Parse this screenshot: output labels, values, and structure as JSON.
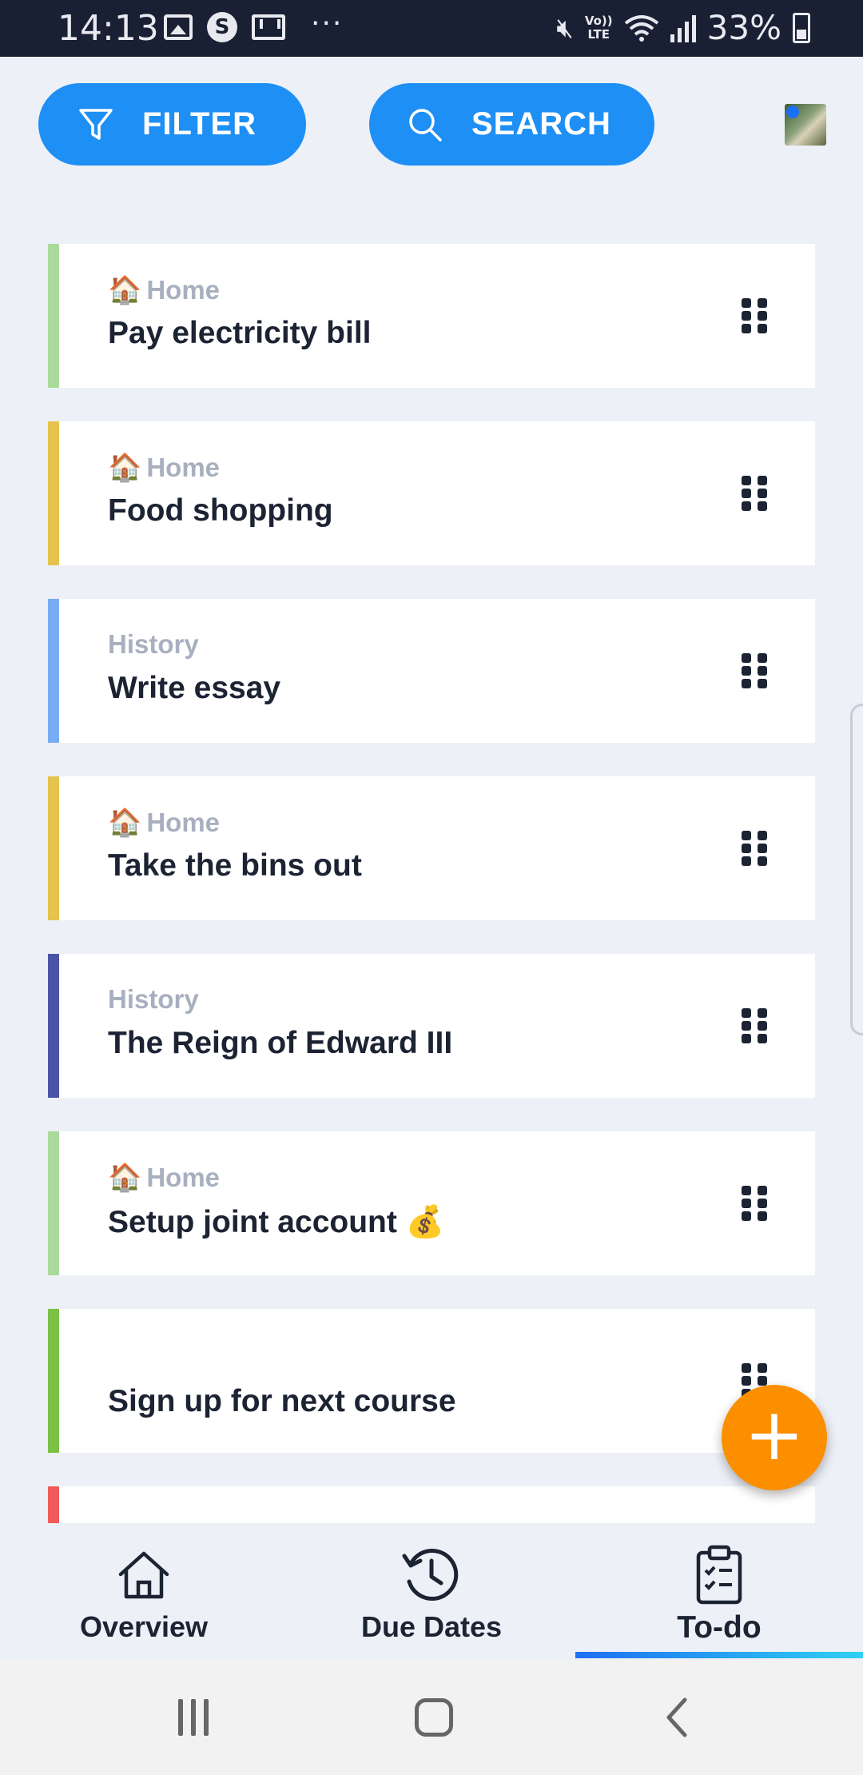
{
  "status_bar": {
    "time": "14:13",
    "volte": "Vo))\nLTE",
    "battery": "33%"
  },
  "toolbar": {
    "filter_label": "FILTER",
    "search_label": "SEARCH"
  },
  "colors": {
    "accent": "#1e8ff5",
    "fab": "#fb8f00",
    "text_dark": "#1c2333",
    "category_grey": "#a8b0c0"
  },
  "tasks": [
    {
      "category": "Home",
      "category_icon": "house-emoji",
      "title": "Pay electricity bill",
      "bar_color": "#a9d99b"
    },
    {
      "category": "Home",
      "category_icon": "house-emoji",
      "title": "Food shopping",
      "bar_color": "#e5c34d"
    },
    {
      "category": "History",
      "category_icon": "",
      "title": "Write essay",
      "bar_color": "#7aabf5"
    },
    {
      "category": "Home",
      "category_icon": "house-emoji",
      "title": "Take the bins out",
      "bar_color": "#e5c34d"
    },
    {
      "category": "History",
      "category_icon": "",
      "title": "The Reign of Edward III",
      "bar_color": "#4a54a6"
    },
    {
      "category": "Home",
      "category_icon": "house-emoji",
      "title": "Setup joint account 💰",
      "bar_color": "#a9d99b"
    },
    {
      "category": "",
      "category_icon": "",
      "title": "Sign up for next course",
      "bar_color": "#7cc044"
    },
    {
      "category": "",
      "category_icon": "",
      "title": "",
      "bar_color": "#f05a5a"
    }
  ],
  "fab": {
    "label": "+"
  },
  "bottom_nav": {
    "items": [
      {
        "label": "Overview",
        "icon": "home-icon"
      },
      {
        "label": "Due Dates",
        "icon": "history-clock-icon"
      },
      {
        "label": "To-do",
        "icon": "clipboard-checklist-icon",
        "active": true
      }
    ]
  }
}
